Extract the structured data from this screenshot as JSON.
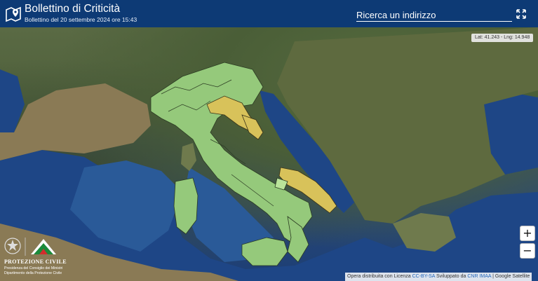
{
  "header": {
    "title": "Bollettino di Criticità",
    "subtitle": "Bollettino del 20 settembre 2024 ore 15:43",
    "search_placeholder": "Ricerca un indirizzo",
    "app_icon": "map-pin-icon",
    "fullscreen_icon": "expand-icon"
  },
  "map": {
    "coordinates_readout": "Lat: 41.243 - Lng: 14.948",
    "zoom_in_label": "+",
    "zoom_out_label": "−",
    "legend_colors": {
      "green": "#95c97b",
      "yellow": "#d8c25a",
      "light_green": "#b9e39a"
    }
  },
  "attribution": {
    "prefix": "Opera distribuita con Licenza ",
    "license_link": "CC-BY-SA",
    "middle": " Sviluppato da ",
    "dev_link": "CNR IMAA",
    "suffix": " | Google Satellite"
  },
  "logo": {
    "title": "PROTEZIONE CIVILE",
    "line1": "Presidenza del Consiglio dei Ministri",
    "line2": "Dipartimento della Protezione Civile"
  },
  "colors": {
    "header_bg": "#0d3a75",
    "header_text": "#ffffff"
  }
}
